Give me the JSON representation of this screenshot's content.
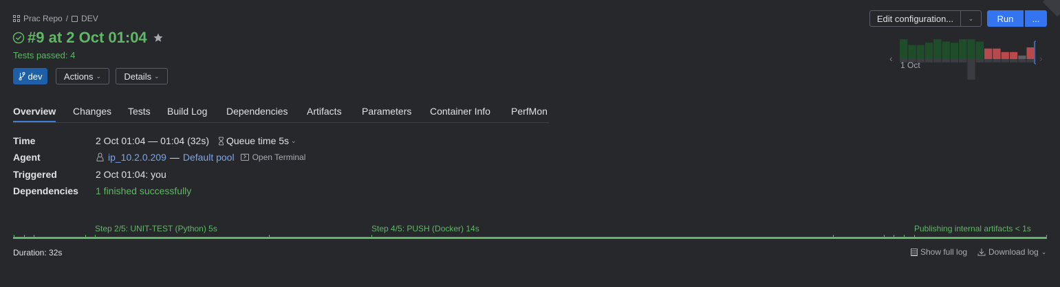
{
  "breadcrumb": {
    "project": "Prac Repo",
    "separator": "/",
    "config": "DEV"
  },
  "build": {
    "title": "#9 at 2 Oct 01:04",
    "tests_passed": "Tests passed: 4",
    "branch": "dev",
    "actions_label": "Actions",
    "details_label": "Details"
  },
  "tabs": [
    "Overview",
    "Changes",
    "Tests",
    "Build Log",
    "Dependencies",
    "Artifacts",
    "Parameters",
    "Container Info",
    "PerfMon"
  ],
  "info": {
    "time_label": "Time",
    "time_value": "2 Oct 01:04 — 01:04 (32s)",
    "queue_time": "Queue time 5s",
    "agent_label": "Agent",
    "agent_name": "ip_10.2.0.209",
    "agent_sep": "—",
    "agent_pool": "Default pool",
    "open_terminal": "Open Terminal",
    "triggered_label": "Triggered",
    "triggered_value": "2 Oct 01:04: you",
    "dependencies_label": "Dependencies",
    "dependencies_value": "1 finished successfully"
  },
  "timeline": {
    "steps": [
      "Step 2/5: UNIT-TEST (Python) 5s",
      "Step 4/5: PUSH (Docker) 14s",
      "Publishing internal artifacts < 1s"
    ],
    "duration": "Duration: 32s"
  },
  "log": {
    "show_full": "Show full log",
    "download": "Download log"
  },
  "toolbar": {
    "edit_config": "Edit configuration...",
    "run": "Run",
    "more": "..."
  },
  "history": {
    "date_label": "1 Oct",
    "bars": [
      {
        "status": "success",
        "height": 0.85
      },
      {
        "status": "success",
        "height": 0.6
      },
      {
        "status": "success",
        "height": 0.6
      },
      {
        "status": "success",
        "height": 0.7
      },
      {
        "status": "success",
        "height": 0.85
      },
      {
        "status": "success",
        "height": 0.75
      },
      {
        "status": "success",
        "height": 0.7
      },
      {
        "status": "success",
        "height": 0.85
      },
      {
        "status": "success",
        "height": 0.85
      },
      {
        "status": "success",
        "height": 0.75
      },
      {
        "status": "failed",
        "height": 0.45
      },
      {
        "status": "failed",
        "height": 0.45
      },
      {
        "status": "failed",
        "height": 0.3
      },
      {
        "status": "failed",
        "height": 0.3
      },
      {
        "status": "neutral",
        "height": 0.15
      },
      {
        "status": "failed",
        "height": 0.5
      },
      {
        "status": "success",
        "height": 0.7
      }
    ],
    "colors": {
      "success": "#1f4d2a",
      "failed": "#b8494c",
      "neutral": "#5c5f66",
      "selected": "#3574f0"
    }
  }
}
